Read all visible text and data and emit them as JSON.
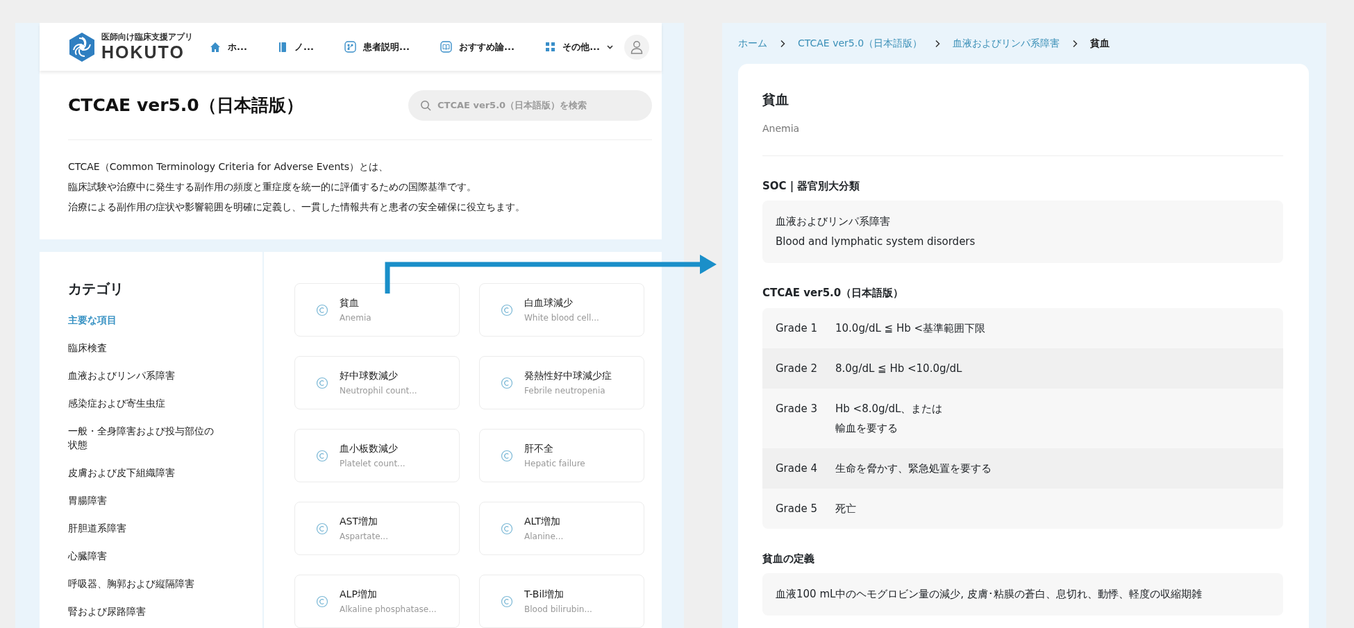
{
  "left_screen": {
    "header": {
      "logo_tagline": "医師向け臨床支援アプリ",
      "logo_name": "HOKUTO",
      "nav": [
        {
          "label": "ホ...",
          "kind": "link"
        },
        {
          "label": "ノ...",
          "kind": "link"
        },
        {
          "label": "患者説明...",
          "kind": "link"
        },
        {
          "label": "おすすめ論...",
          "kind": "link"
        },
        {
          "label": "その他...",
          "kind": "dropdown"
        }
      ]
    },
    "page_title": "CTCAE ver5.0（日本語版）",
    "search": {
      "placeholder": "CTCAE ver5.0（日本語版）を検索"
    },
    "description": [
      "CTCAE（Common Terminology Criteria for Adverse Events）とは、",
      "臨床試験や治療中に発生する副作用の頻度と重症度を統一的に評価するための国際基準です。",
      "治療による副作用の症状や影響範囲を明確に定義し、一貫した情報共有と患者の安全確保に役立ちます。"
    ],
    "sidebar": {
      "title": "カテゴリ",
      "items": [
        {
          "label": "主要な項目",
          "selected": true
        },
        {
          "label": "臨床検査",
          "selected": false
        },
        {
          "label": "血液およびリンパ系障害",
          "selected": false
        },
        {
          "label": "感染症および寄生虫症",
          "selected": false
        },
        {
          "label": "一般・全身障害および投与部位の状態",
          "selected": false
        },
        {
          "label": "皮膚および皮下組織障害",
          "selected": false
        },
        {
          "label": "胃腸障害",
          "selected": false
        },
        {
          "label": "肝胆道系障害",
          "selected": false
        },
        {
          "label": "心臓障害",
          "selected": false
        },
        {
          "label": "呼吸器、胸郭および縦隔障害",
          "selected": false
        },
        {
          "label": "腎および尿路障害",
          "selected": false
        }
      ]
    },
    "cards": [
      {
        "title": "貧血",
        "subtitle": "Anemia"
      },
      {
        "title": "白血球減少",
        "subtitle": "White blood cell..."
      },
      {
        "title": "好中球数減少",
        "subtitle": "Neutrophil count..."
      },
      {
        "title": "発熱性好中球減少症",
        "subtitle": "Febrile neutropenia"
      },
      {
        "title": "血小板数減少",
        "subtitle": "Platelet count..."
      },
      {
        "title": "肝不全",
        "subtitle": "Hepatic failure"
      },
      {
        "title": "AST増加",
        "subtitle": "Aspartate..."
      },
      {
        "title": "ALT増加",
        "subtitle": "Alanine..."
      },
      {
        "title": "ALP増加",
        "subtitle": "Alkaline phosphatase..."
      },
      {
        "title": "T-Bil増加",
        "subtitle": "Blood bilirubin..."
      }
    ]
  },
  "right_screen": {
    "breadcrumb": [
      {
        "label": "ホーム",
        "current": false
      },
      {
        "label": "CTCAE ver5.0（日本語版）",
        "current": false
      },
      {
        "label": "血液およびリンパ系障害",
        "current": false
      },
      {
        "label": "貧血",
        "current": true
      }
    ],
    "title": "貧血",
    "subtitle": "Anemia",
    "soc": {
      "heading": "SOC | 器官別大分類",
      "lines": [
        "血液およびリンパ系障害",
        "Blood and lymphatic system disorders"
      ]
    },
    "ctcae": {
      "heading": "CTCAE ver5.0（日本語版）",
      "grades": [
        {
          "grade": "Grade 1",
          "lines": [
            "10.0g/dL ≦ Hb <基準範囲下限"
          ]
        },
        {
          "grade": "Grade 2",
          "lines": [
            "8.0g/dL ≦ Hb <10.0g/dL"
          ]
        },
        {
          "grade": "Grade 3",
          "lines": [
            "Hb <8.0g/dL、または",
            "輸血を要する"
          ]
        },
        {
          "grade": "Grade 4",
          "lines": [
            "生命を脅かす、緊急処置を要する"
          ]
        },
        {
          "grade": "Grade 5",
          "lines": [
            "死亡"
          ]
        }
      ]
    },
    "definition": {
      "heading": "貧血の定義",
      "text": "血液100 mL中のヘモグロビン量の減少, 皮膚･粘膜の蒼白、息切れ、動悸、軽度の収縮期雑"
    }
  }
}
